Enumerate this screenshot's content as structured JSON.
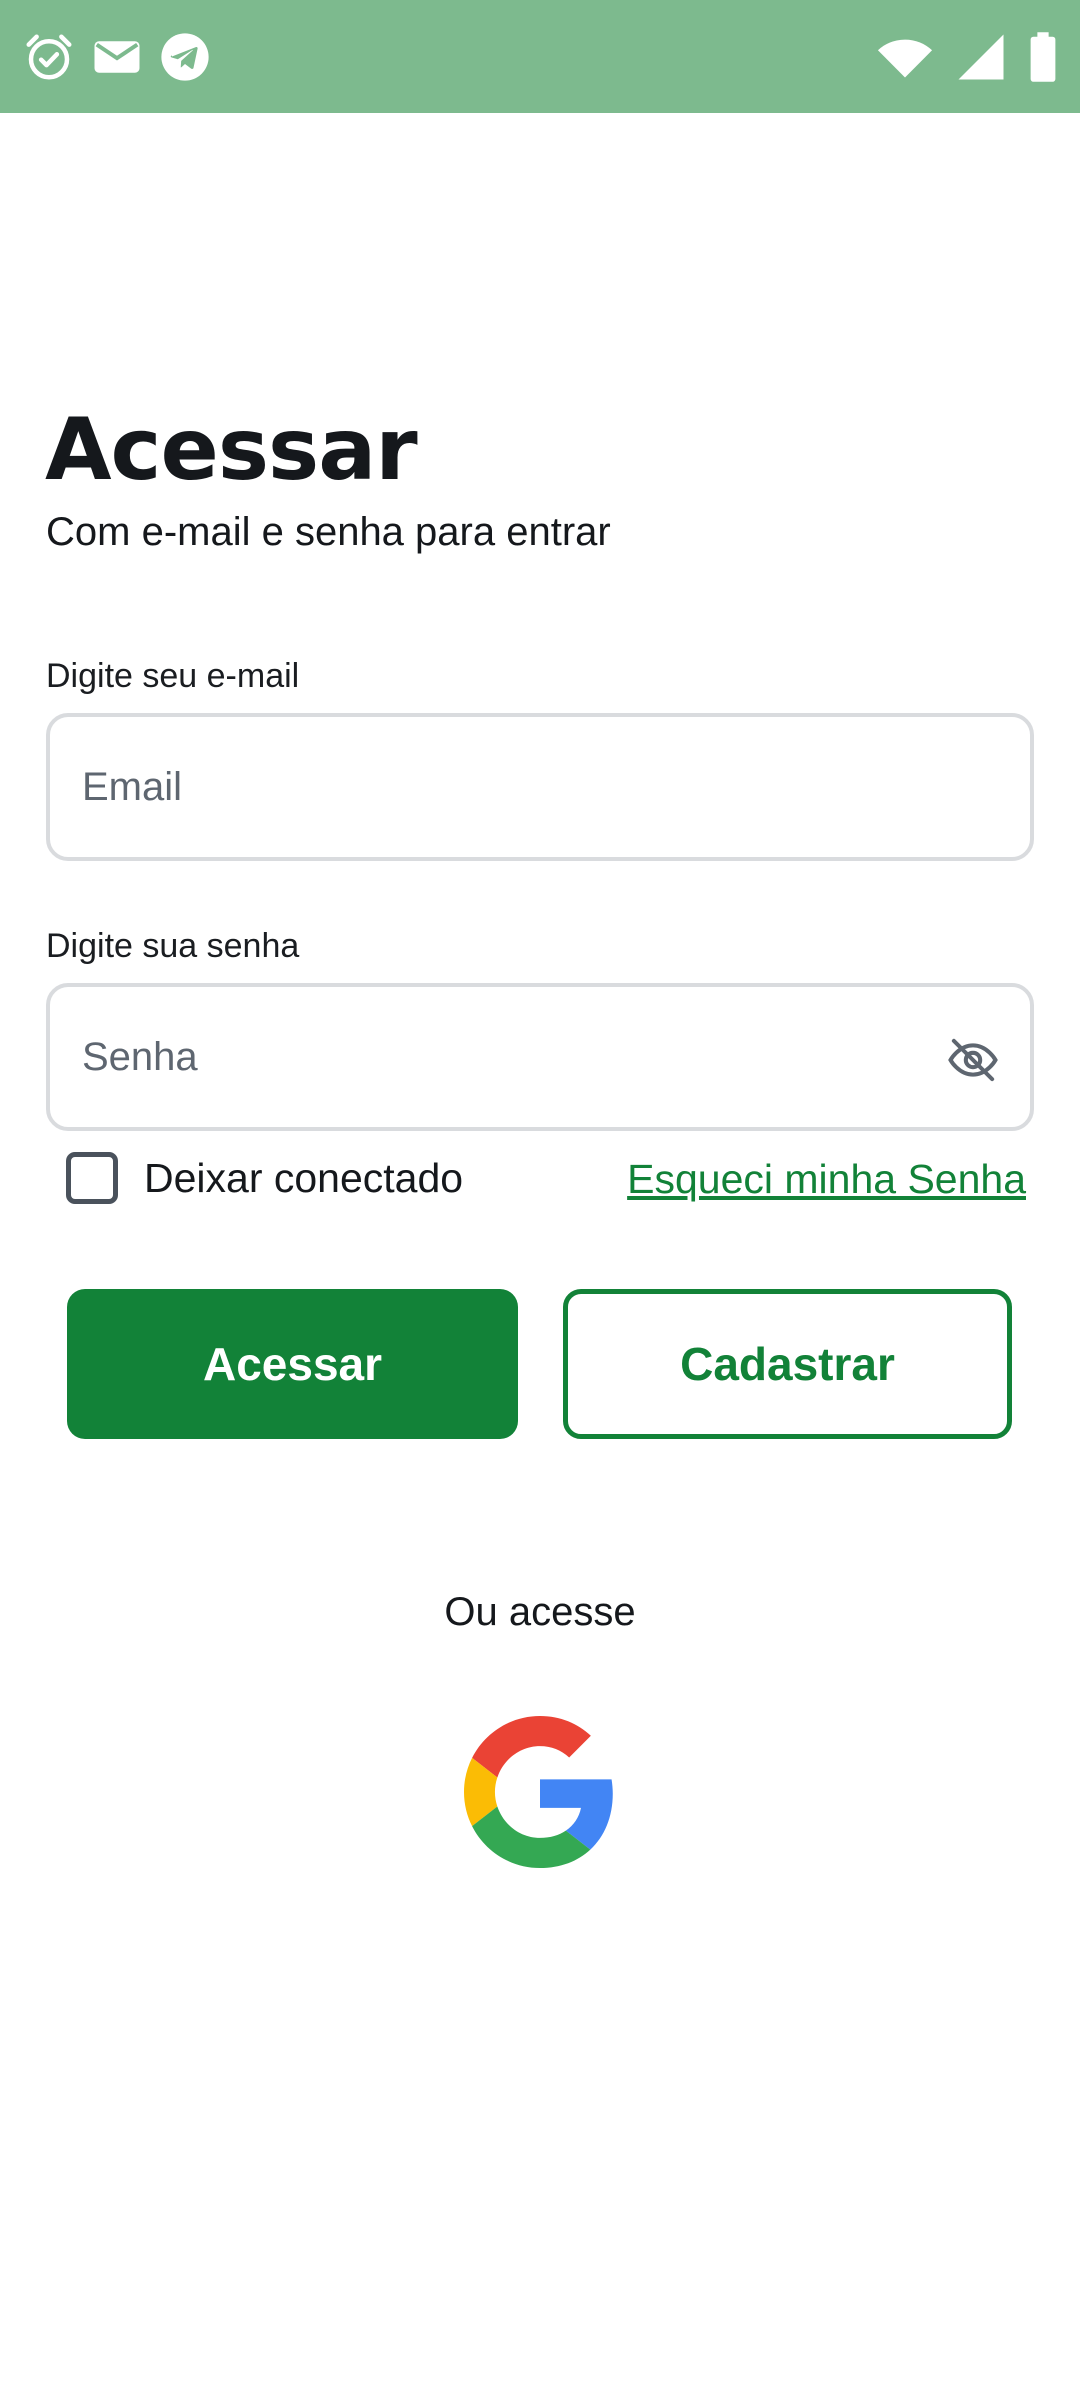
{
  "status_bar": {
    "background": "#7dba8e",
    "left_icons": [
      "alarm-icon",
      "mail-icon",
      "telegram-icon"
    ],
    "right_icons": [
      "wifi-icon",
      "signal-icon",
      "battery-icon"
    ]
  },
  "login": {
    "title": "Acessar",
    "subtitle": "Com e-mail e senha para entrar",
    "email": {
      "label": "Digite seu e-mail",
      "placeholder": "Email",
      "value": ""
    },
    "password": {
      "label": "Digite sua senha",
      "placeholder": "Senha",
      "value": "",
      "toggle_icon": "eye-off-icon"
    },
    "remember_me": {
      "label": "Deixar conectado",
      "checked": false
    },
    "forgot_password_link": "Esqueci minha Senha",
    "submit_button": "Acessar",
    "register_button": "Cadastrar",
    "alt_login_text": "Ou acesse",
    "alt_login_provider_icon": "google-icon"
  },
  "colors": {
    "accent": "#128238",
    "status_bar": "#7dba8e"
  }
}
